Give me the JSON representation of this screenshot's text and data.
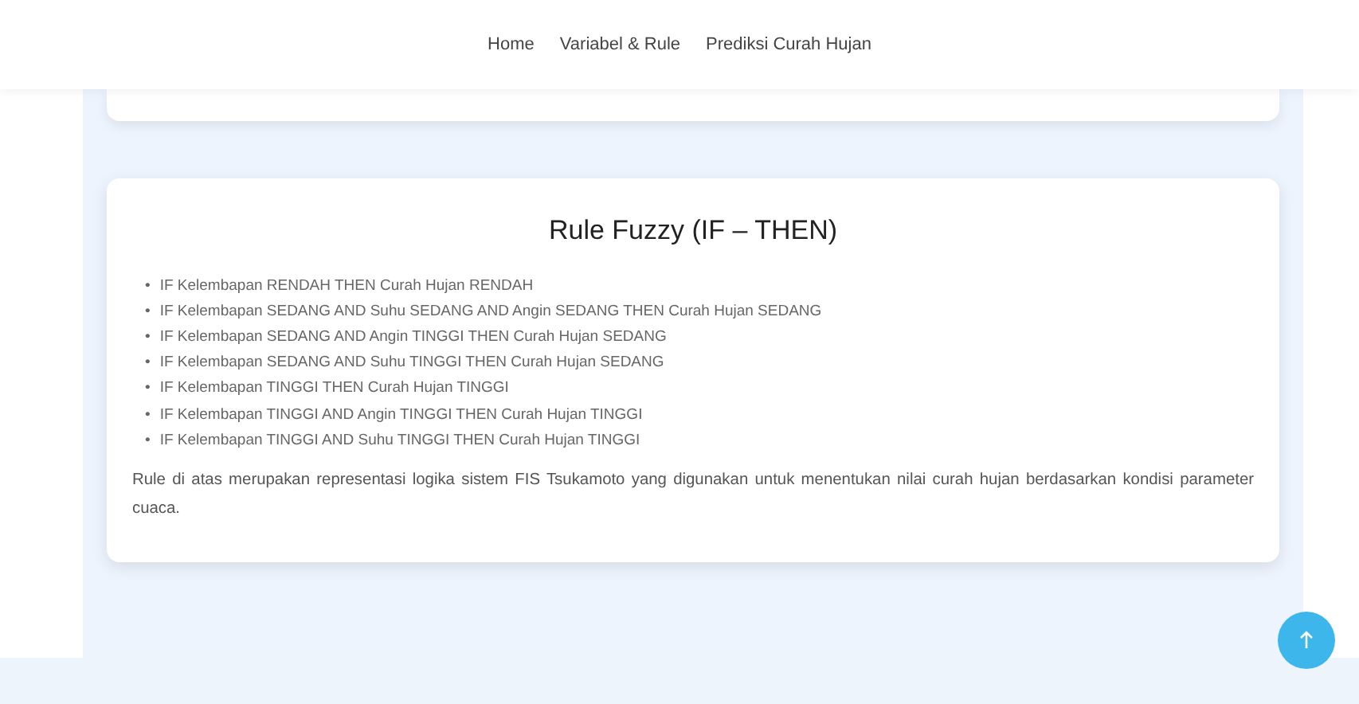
{
  "nav": {
    "links": [
      {
        "label": "Home"
      },
      {
        "label": "Variabel & Rule"
      },
      {
        "label": "Prediksi Curah Hujan"
      }
    ]
  },
  "rule_card": {
    "title": "Rule Fuzzy (IF – THEN)",
    "rules": [
      {
        "bullet": "•",
        "text": "IF Kelembapan RENDAH THEN Curah Hujan RENDAH"
      },
      {
        "bullet": "•",
        "text": "IF Kelembapan SEDANG AND Suhu SEDANG AND Angin SEDANG THEN Curah Hujan SEDANG"
      },
      {
        "bullet": "•",
        "text": "IF Kelembapan SEDANG AND Angin TINGGI THEN Curah Hujan SEDANG"
      },
      {
        "bullet": "•",
        "text": "IF Kelembapan SEDANG AND Suhu TINGGI THEN Curah Hujan SEDANG"
      },
      {
        "bullet": "•",
        "text": "IF Kelembapan TINGGI THEN Curah Hujan TINGGI"
      },
      {
        "bullet": "•",
        "text": "IF Kelembapan TINGGI AND Angin TINGGI THEN Curah Hujan TINGGI"
      },
      {
        "bullet": "•",
        "text": "IF Kelembapan TINGGI AND Suhu TINGGI THEN Curah Hujan TINGGI"
      }
    ],
    "note": "Rule di atas merupakan representasi logika sistem FIS Tsukamoto yang digunakan untuk menentukan nilai curah hujan berdasarkan kondisi parameter cuaca."
  }
}
